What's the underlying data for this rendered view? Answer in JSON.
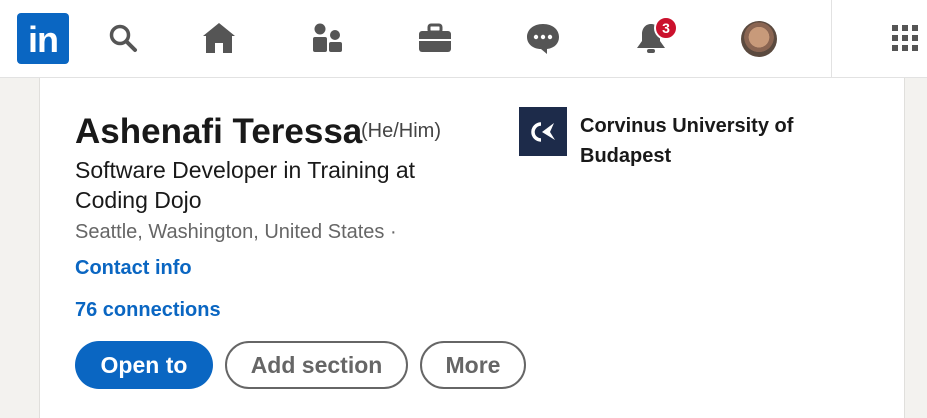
{
  "nav": {
    "logo_text": "in",
    "items": [
      {
        "icon": "search-icon"
      },
      {
        "icon": "home-icon"
      },
      {
        "icon": "my-network-icon"
      },
      {
        "icon": "jobs-briefcase-icon"
      },
      {
        "icon": "messaging-icon"
      },
      {
        "icon": "notifications-bell-icon",
        "badge": "3"
      },
      {
        "icon": "profile-avatar"
      },
      {
        "icon": "apps-grid-icon"
      }
    ],
    "notification_count": "3",
    "brand_color": "#0a66c2",
    "badge_color": "#cb112d"
  },
  "profile": {
    "name": "Ashenafi Teressa",
    "pronouns": "(He/Him)",
    "headline": "Software Developer in Training at Coding Dojo",
    "location": "Seattle, Washington, United States ·",
    "contact_info_link": "Contact info",
    "connections_link": "76 connections"
  },
  "actions": {
    "open_to": "Open to",
    "add_section": "Add section",
    "more": "More"
  },
  "education": {
    "logo_icon": "corvinus-logo",
    "name": "Corvinus University of Budapest"
  }
}
